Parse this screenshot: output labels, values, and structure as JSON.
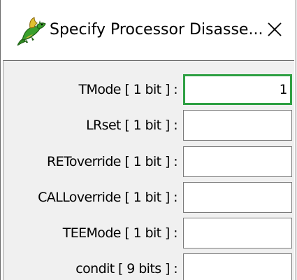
{
  "window": {
    "title": "Specify Processor Disasse...",
    "icon": "dragon-icon",
    "close_glyph": "✕"
  },
  "fields": [
    {
      "label": "TMode [ 1 bit ] :",
      "value": "1",
      "focused": true
    },
    {
      "label": "LRset [ 1 bit ] :",
      "value": "",
      "focused": false
    },
    {
      "label": "REToverride [ 1 bit ] :",
      "value": "",
      "focused": false
    },
    {
      "label": "CALLoverride [ 1 bit ] :",
      "value": "",
      "focused": false
    },
    {
      "label": "TEEMode [ 1 bit ] :",
      "value": "",
      "focused": false
    },
    {
      "label": "condit [ 9 bits ] :",
      "value": "",
      "focused": false
    }
  ],
  "colors": {
    "focus_border": "#2ea043",
    "panel_background": "#f0f0f0",
    "input_border": "#7a7a7a",
    "dragon_green": "#3aa02c"
  }
}
